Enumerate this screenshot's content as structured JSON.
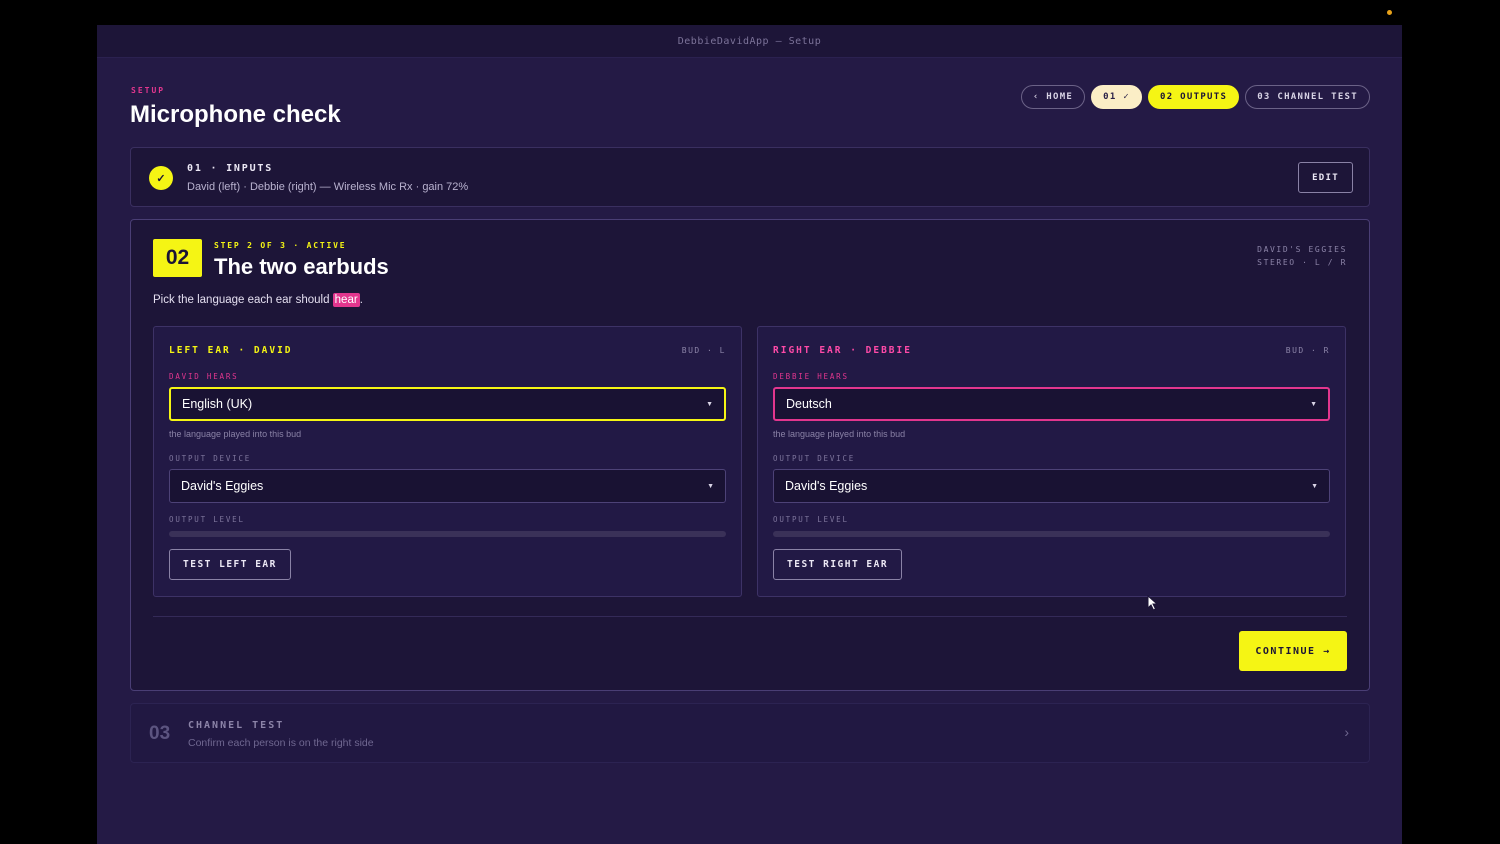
{
  "window": {
    "title": "DebbieDavidApp — Setup"
  },
  "header": {
    "eyebrow": "SETUP",
    "title": "Microphone check"
  },
  "nav": {
    "home": "‹ HOME",
    "step1": "01 ✓",
    "step2": "02 OUTPUTS",
    "step3": "03 CHANNEL TEST"
  },
  "step1": {
    "check": "✓",
    "title": "01 · INPUTS",
    "summary": "David (left) · Debbie (right) — Wireless Mic Rx · gain 72%",
    "edit_label": "EDIT"
  },
  "step2": {
    "number": "02",
    "label": "STEP 2 OF 3 · ACTIVE",
    "title": "The two earbuds",
    "device_line1": "DAVID'S EGGIES",
    "device_line2": "STEREO · L / R",
    "instruction_before": "Pick the language each ear should ",
    "instruction_highlight": "hear",
    "instruction_after": ".",
    "left": {
      "title": "LEFT EAR · DAVID",
      "tag": "BUD · L",
      "hears_label": "DAVID HEARS",
      "language": "English (UK)",
      "hint": "the language played into this bud",
      "device_label": "OUTPUT DEVICE",
      "device": "David's Eggies",
      "level_label": "OUTPUT LEVEL",
      "level": 0,
      "test_label": "TEST LEFT EAR"
    },
    "right": {
      "title": "RIGHT EAR · DEBBIE",
      "tag": "BUD · R",
      "hears_label": "DEBBIE HEARS",
      "language": "Deutsch",
      "hint": "the language played into this bud",
      "device_label": "OUTPUT DEVICE",
      "device": "David's Eggies",
      "level_label": "OUTPUT LEVEL",
      "level": 0,
      "test_label": "TEST RIGHT EAR"
    },
    "continue_label": "CONTINUE →"
  },
  "step3": {
    "number": "03",
    "title": "CHANNEL TEST",
    "subtitle": "Confirm each person is on the right side",
    "chevron": "›"
  },
  "colors": {
    "accent_yellow": "#f5f514",
    "accent_pink": "#e2368e",
    "background": "#241a45",
    "card": "#1d1538"
  }
}
